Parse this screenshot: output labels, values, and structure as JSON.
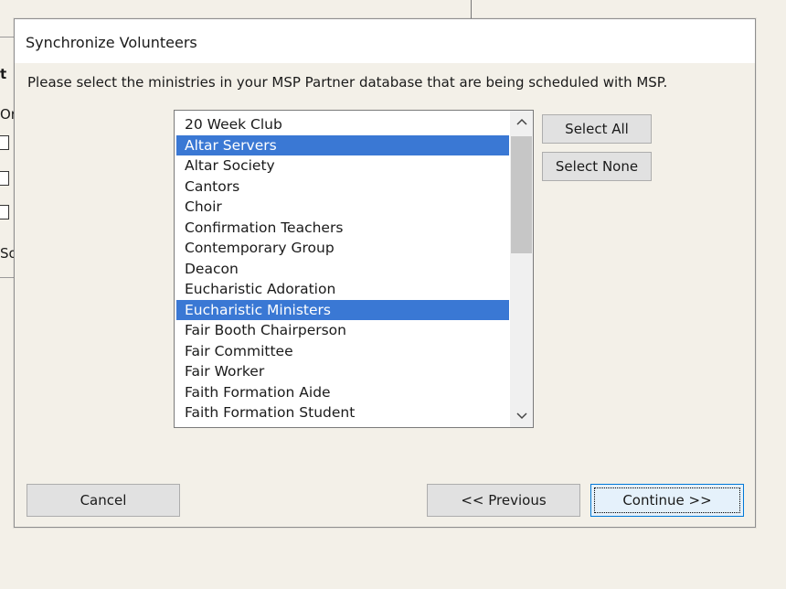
{
  "background": {
    "fragments": [
      "t",
      "Or",
      "So"
    ]
  },
  "dialog": {
    "title": "Synchronize Volunteers",
    "instruction": "Please select the ministries in your MSP Partner database that are being scheduled with MSP.",
    "ministries": [
      {
        "label": "20 Week Club",
        "selected": false
      },
      {
        "label": "Altar Servers",
        "selected": true
      },
      {
        "label": "Altar Society",
        "selected": false
      },
      {
        "label": "Cantors",
        "selected": false
      },
      {
        "label": "Choir",
        "selected": false
      },
      {
        "label": "Confirmation Teachers",
        "selected": false
      },
      {
        "label": "Contemporary Group",
        "selected": false
      },
      {
        "label": "Deacon",
        "selected": false
      },
      {
        "label": "Eucharistic Adoration",
        "selected": false
      },
      {
        "label": "Eucharistic Ministers",
        "selected": true
      },
      {
        "label": "Fair Booth Chairperson",
        "selected": false
      },
      {
        "label": "Fair Committee",
        "selected": false
      },
      {
        "label": "Fair Worker",
        "selected": false
      },
      {
        "label": "Faith Formation Aide",
        "selected": false
      },
      {
        "label": "Faith Formation Student",
        "selected": false
      }
    ],
    "select_all_label": "Select All",
    "select_none_label": "Select None",
    "cancel_label": "Cancel",
    "previous_label": "<< Previous",
    "continue_label": "Continue >>",
    "scroll_up_icon": "chevron-up-icon",
    "scroll_down_icon": "chevron-down-icon",
    "selection_color": "#3a78d4"
  }
}
